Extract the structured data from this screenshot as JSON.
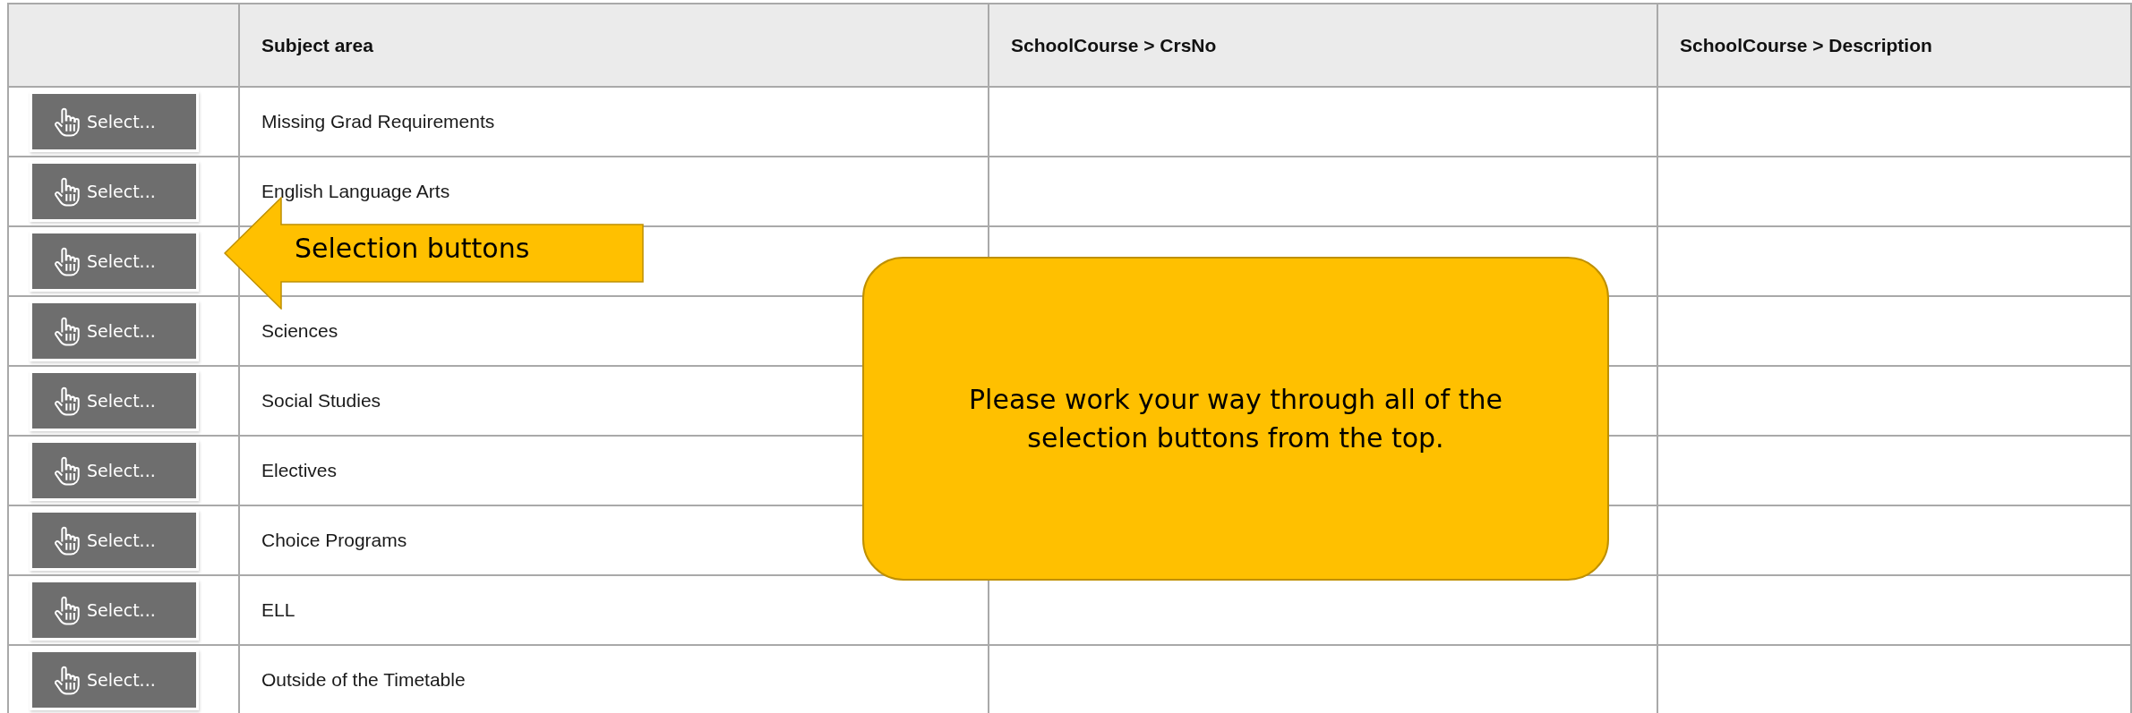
{
  "table": {
    "columns": [
      {
        "label": "Subject area"
      },
      {
        "label": "SchoolCourse > CrsNo"
      },
      {
        "label": "SchoolCourse > Description"
      }
    ],
    "rows": [
      {
        "button": "Select...",
        "subject": "Missing Grad Requirements"
      },
      {
        "button": "Select...",
        "subject": "English Language Arts"
      },
      {
        "button": "Select..."
      },
      {
        "button": "Select...",
        "subject": "Sciences"
      },
      {
        "button": "Select...",
        "subject": "Social Studies"
      },
      {
        "button": "Select...",
        "subject": "Electives"
      },
      {
        "button": "Select...",
        "subject": "Choice Programs"
      },
      {
        "button": "Select...",
        "subject": "ELL"
      },
      {
        "button": "Select...",
        "subject": "Outside of the Timetable"
      }
    ]
  },
  "arrow_callout": {
    "text": "Selection buttons"
  },
  "note_callout": {
    "text": "Please work your way through all of the selection buttons from the top."
  }
}
